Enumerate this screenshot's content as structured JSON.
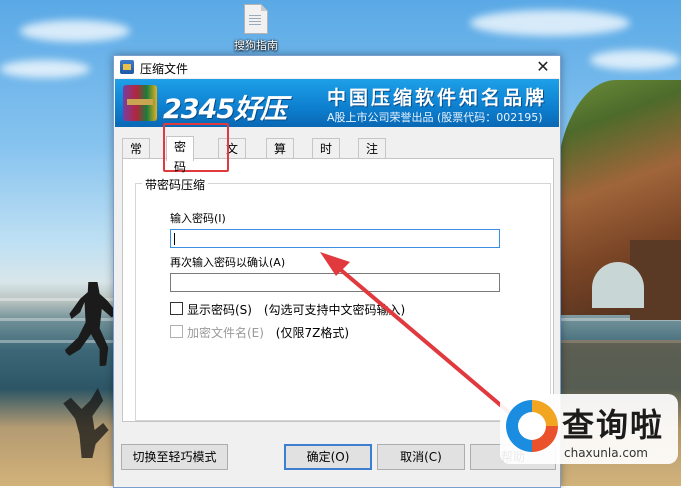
{
  "desktop": {
    "icon_label": "搜狗指南"
  },
  "dialog": {
    "title": "压缩文件",
    "close_glyph": "✕",
    "banner": {
      "brand": "2345好压",
      "slogan": "中国压缩软件知名品牌",
      "subtitle": "A股上市公司荣誉出品 (股票代码：002195)"
    },
    "tabs": [
      {
        "label": "常规",
        "active": false
      },
      {
        "label": "密码",
        "active": true
      },
      {
        "label": "文件",
        "active": false
      },
      {
        "label": "算法",
        "active": false
      },
      {
        "label": "时间",
        "active": false
      },
      {
        "label": "注释",
        "active": false
      }
    ],
    "password_group": {
      "title": "带密码压缩",
      "enter_label": "输入密码(I)",
      "enter_value": "",
      "confirm_label": "再次输入密码以确认(A)",
      "confirm_value": "",
      "show_password_label": "显示密码(S)",
      "show_password_hint": "(勾选可支持中文密码输入)",
      "encrypt_names_label": "加密文件名(E)",
      "encrypt_names_hint": "(仅限7Z格式)"
    },
    "buttons": {
      "switch_mode": "切换至轻巧模式",
      "ok": "确定(O)",
      "cancel": "取消(C)",
      "help": "帮助"
    }
  },
  "annotations": {
    "highlight_color": "#e0393e"
  },
  "watermark": {
    "title": "查询啦",
    "domain": "chaxunla.com"
  }
}
